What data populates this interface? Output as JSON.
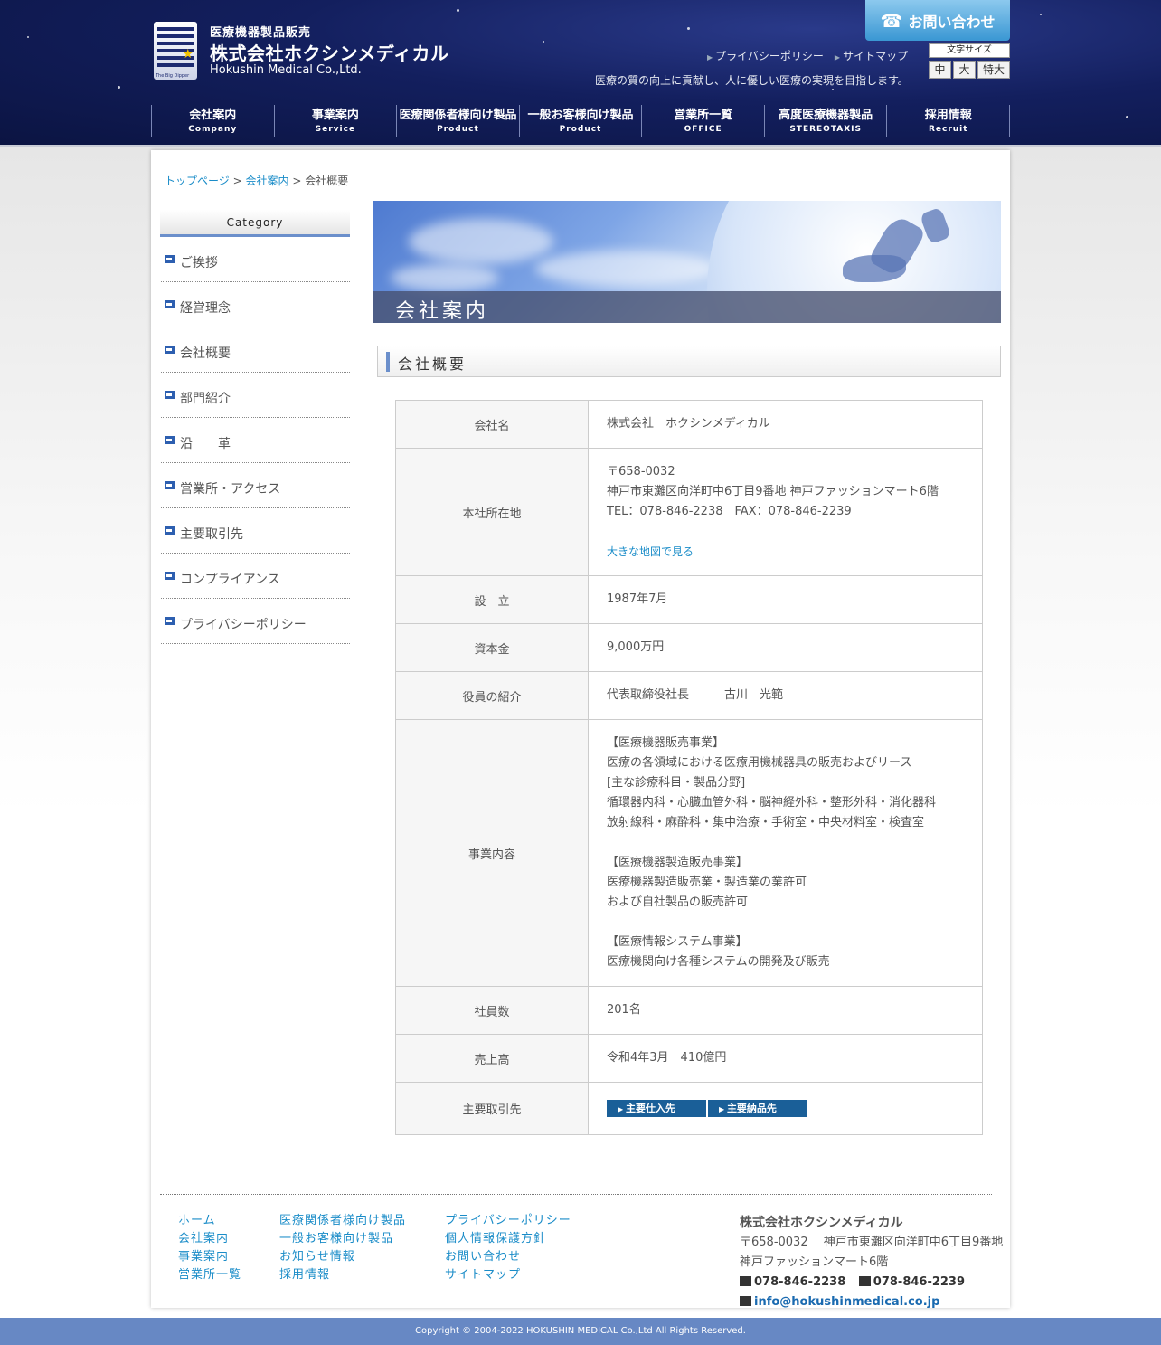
{
  "header": {
    "logo_sub": "医療機器製品販売",
    "logo_main": "株式会社ホクシンメディカル",
    "logo_en": "Hokushin Medical Co.,Ltd.",
    "logo_mark_text": "The Big Dipper",
    "contact_label": "お問い合わせ",
    "top_links": [
      "プライバシーポリシー",
      "サイトマップ"
    ],
    "font_size_label": "文字サイズ",
    "font_sizes": [
      "中",
      "大",
      "特大"
    ],
    "tagline": "医療の質の向上に貢献し、人に優しい医療の実現を目指します。"
  },
  "nav": [
    {
      "jp": "会社案内",
      "en": "Company"
    },
    {
      "jp": "事業案内",
      "en": "Service"
    },
    {
      "jp": "医療関係者様向け製品",
      "en": "Product"
    },
    {
      "jp": "一般お客様向け製品",
      "en": "Product"
    },
    {
      "jp": "営業所一覧",
      "en": "OFFICE"
    },
    {
      "jp": "高度医療機器製品",
      "en": "STEREOTAXIS"
    },
    {
      "jp": "採用情報",
      "en": "Recruit"
    }
  ],
  "breadcrumb": {
    "home": "トップページ",
    "parent": "会社案内",
    "current": "会社概要",
    "sep": ">"
  },
  "sidebar": {
    "heading": "Category",
    "items": [
      "ご挨拶",
      "経営理念",
      "会社概要",
      "部門紹介",
      "沿　　革",
      "営業所・アクセス",
      "主要取引先",
      "コンプライアンス",
      "プライバシーポリシー"
    ]
  },
  "hero_title": "会社案内",
  "section_title": "会社概要",
  "overview": {
    "company_name": {
      "label": "会社名",
      "value": "株式会社　ホクシンメディカル"
    },
    "address": {
      "label": "本社所在地",
      "zip": "〒658-0032",
      "street": "神戸市東灘区向洋町中6丁目9番地 神戸ファッションマート6階",
      "tel": "TEL：078-846-2238　FAX：078-846-2239",
      "map_link": "大きな地図で見る"
    },
    "founded": {
      "label": "設　立",
      "value": "1987年7月"
    },
    "capital": {
      "label": "資本金",
      "value": "9,000万円"
    },
    "officers": {
      "label": "役員の紹介",
      "value": "代表取締役社長　　　古川　光範"
    },
    "business": {
      "label": "事業内容",
      "lines": [
        "【医療機器販売事業】",
        "医療の各領域における医療用機械器具の販売およびリース",
        "[主な診療科目・製品分野]",
        "循環器内科・心臓血管外科・脳神経外科・整形外科・消化器科",
        "放射線科・麻酔科・集中治療・手術室・中央材料室・検査室",
        "",
        "【医療機器製造販売事業】",
        "医療機器製造販売業・製造業の業許可",
        "および自社製品の販売許可",
        "",
        "【医療情報システム事業】",
        "医療機関向け各種システムの開発及び販売"
      ]
    },
    "employees": {
      "label": "社員数",
      "value": "201名"
    },
    "sales": {
      "label": "売上高",
      "value": "令和4年3月　410億円"
    },
    "partners": {
      "label": "主要取引先",
      "buttons": [
        "主要仕入先",
        "主要納品先"
      ]
    }
  },
  "footer": {
    "col1": [
      "ホーム",
      "会社案内",
      "事業案内",
      "営業所一覧"
    ],
    "col2": [
      "医療関係者様向け製品",
      "一般お客様向け製品",
      "お知らせ情報",
      "採用情報"
    ],
    "col3": [
      "プライバシーポリシー",
      "個人情報保護方針",
      "お問い合わせ",
      "サイトマップ"
    ],
    "company": {
      "name": "株式会社ホクシンメディカル",
      "addr1": "〒658-0032　 神戸市東灘区向洋町中6丁目9番地",
      "addr2": "神戸ファッションマート6階",
      "tel": "078-846-2238",
      "fax": "078-846-2239",
      "email": "info@hokushinmedical.co.jp"
    },
    "copyright": "Copyright © 2004-2022 HOKUSHIN MEDICAL Co.,Ltd All Rights Reserved."
  },
  "colors": {
    "accent": "#6b8fcb",
    "link": "#1a8cc8",
    "header_bg": "#131f5e",
    "button": "#1a5f98"
  }
}
